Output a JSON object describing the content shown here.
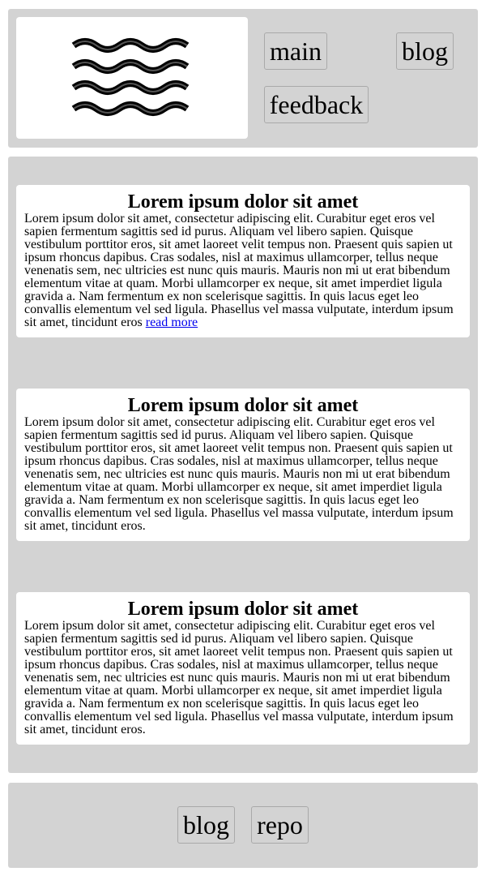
{
  "header": {
    "logo_icon": "waves-icon",
    "nav": {
      "main_label": "main",
      "blog_label": "blog",
      "feedback_label": "feedback"
    }
  },
  "posts": [
    {
      "title": "Lorem ipsum dolor sit amet",
      "body": "Lorem ipsum dolor sit amet, consectetur adipiscing elit. Curabitur eget eros vel sapien fermentum sagittis sed id purus. Aliquam vel libero sapien. Quisque vestibulum porttitor eros, sit amet laoreet velit tempus non. Praesent quis sapien ut ipsum rhoncus dapibus. Cras sodales, nisl at maximus ullamcorper, tellus neque venenatis sem, nec ultricies est nunc quis mauris. Mauris non mi ut erat bibendum elementum vitae at quam. Morbi ullamcorper ex neque, sit amet imperdiet ligula gravida a. Nam fermentum ex non scelerisque sagittis. In quis lacus eget leo convallis elementum vel sed ligula. Phasellus vel massa vulputate, interdum ipsum sit amet, tincidunt eros ",
      "link_label": "read more"
    },
    {
      "title": "Lorem ipsum dolor sit amet",
      "body": "Lorem ipsum dolor sit amet, consectetur adipiscing elit. Curabitur eget eros vel sapien fermentum sagittis sed id purus. Aliquam vel libero sapien. Quisque vestibulum porttitor eros, sit amet laoreet velit tempus non. Praesent quis sapien ut ipsum rhoncus dapibus. Cras sodales, nisl at maximus ullamcorper, tellus neque venenatis sem, nec ultricies est nunc quis mauris. Mauris non mi ut erat bibendum elementum vitae at quam. Morbi ullamcorper ex neque, sit amet imperdiet ligula gravida a. Nam fermentum ex non scelerisque sagittis. In quis lacus eget leo convallis elementum vel sed ligula. Phasellus vel massa vulputate, interdum ipsum sit amet, tincidunt eros."
    },
    {
      "title": "Lorem ipsum dolor sit amet",
      "body": "Lorem ipsum dolor sit amet, consectetur adipiscing elit. Curabitur eget eros vel sapien fermentum sagittis sed id purus. Aliquam vel libero sapien. Quisque vestibulum porttitor eros, sit amet laoreet velit tempus non. Praesent quis sapien ut ipsum rhoncus dapibus. Cras sodales, nisl at maximus ullamcorper, tellus neque venenatis sem, nec ultricies est nunc quis mauris. Mauris non mi ut erat bibendum elementum vitae at quam. Morbi ullamcorper ex neque, sit amet imperdiet ligula gravida a. Nam fermentum ex non scelerisque sagittis. In quis lacus eget leo convallis elementum vel sed ligula. Phasellus vel massa vulputate, interdum ipsum sit amet, tincidunt eros."
    }
  ],
  "footer": {
    "blog_label": "blog",
    "repo_label": "repo"
  },
  "colors": {
    "panel_bg": "#d3d3d3",
    "card_bg": "#ffffff",
    "link": "#0000ee"
  }
}
